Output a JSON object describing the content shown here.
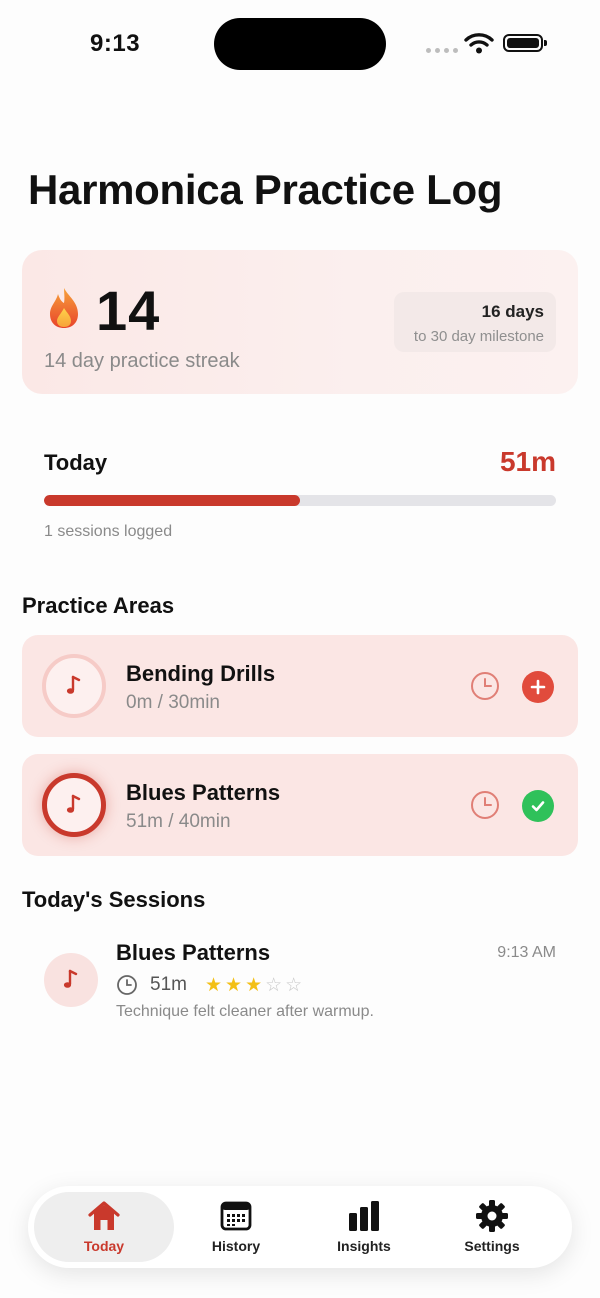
{
  "status_bar": {
    "time": "9:13"
  },
  "page": {
    "title": "Harmonica Practice Log"
  },
  "streak": {
    "count": "14",
    "label": "14 day practice streak",
    "milestone_days": "16 days",
    "milestone_sub": "to 30 day milestone",
    "icon": "flame-icon"
  },
  "today": {
    "label": "Today",
    "total": "51m",
    "progress_percent": 50,
    "sessions_logged": "1 sessions logged"
  },
  "practice_areas": {
    "heading": "Practice Areas",
    "items": [
      {
        "title": "Bending Drills",
        "progress": "0m / 30min",
        "progress_fraction": 0,
        "status": "add"
      },
      {
        "title": "Blues Patterns",
        "progress": "51m / 40min",
        "progress_fraction": 1,
        "status": "complete"
      }
    ]
  },
  "sessions": {
    "heading": "Today's Sessions",
    "items": [
      {
        "title": "Blues Patterns",
        "time": "9:13 AM",
        "duration": "51m",
        "rating": 3,
        "rating_max": 5,
        "note": "Technique felt cleaner after warmup."
      }
    ]
  },
  "tabs": [
    {
      "label": "Today",
      "icon": "house-icon",
      "active": true
    },
    {
      "label": "History",
      "icon": "calendar-icon",
      "active": false
    },
    {
      "label": "Insights",
      "icon": "bar-chart-icon",
      "active": false
    },
    {
      "label": "Settings",
      "icon": "gear-icon",
      "active": false
    }
  ],
  "colors": {
    "accent": "#c9392c",
    "success": "#2fc15a",
    "card_background": "#fbe6e4",
    "star": "#f3c017"
  }
}
